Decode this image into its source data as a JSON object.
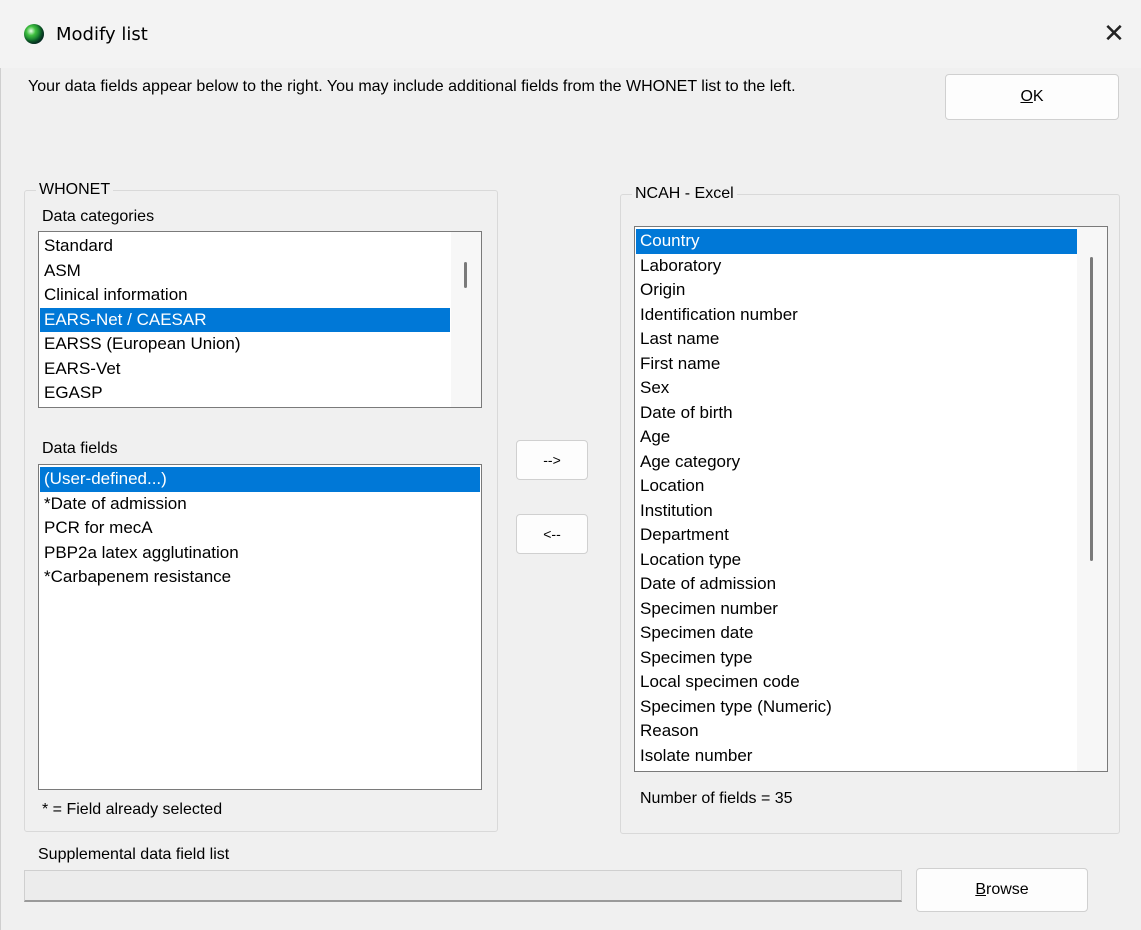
{
  "window": {
    "title": "Modify list"
  },
  "instructions": "Your data fields appear below to the right.  You may include additional fields from the WHONET list to the left.",
  "buttons": {
    "ok": {
      "mnemonic": "O",
      "rest": "K"
    },
    "add": "-->",
    "remove": "<--",
    "browse": {
      "mnemonic": "B",
      "rest": "rowse"
    }
  },
  "left_group": {
    "title": "WHONET",
    "categories_label": "Data categories",
    "categories": [
      {
        "label": "Standard",
        "selected": false
      },
      {
        "label": "ASM",
        "selected": false
      },
      {
        "label": "Clinical information",
        "selected": false
      },
      {
        "label": "EARS-Net / CAESAR",
        "selected": true
      },
      {
        "label": "EARSS (European Union)",
        "selected": false
      },
      {
        "label": "EARS-Vet",
        "selected": false
      },
      {
        "label": "EGASP",
        "selected": false
      }
    ],
    "fields_label": "Data fields",
    "fields": [
      {
        "label": "(User-defined...)",
        "selected": true
      },
      {
        "label": "*Date of admission",
        "selected": false
      },
      {
        "label": "PCR for mecA",
        "selected": false
      },
      {
        "label": "PBP2a latex agglutination",
        "selected": false
      },
      {
        "label": "*Carbapenem resistance",
        "selected": false
      }
    ],
    "footnote": "* = Field already selected"
  },
  "right_group": {
    "title": "NCAH - Excel",
    "fields": [
      {
        "label": "Country",
        "selected": true
      },
      {
        "label": "Laboratory",
        "selected": false
      },
      {
        "label": "Origin",
        "selected": false
      },
      {
        "label": "Identification number",
        "selected": false
      },
      {
        "label": "Last name",
        "selected": false
      },
      {
        "label": "First name",
        "selected": false
      },
      {
        "label": "Sex",
        "selected": false
      },
      {
        "label": "Date of birth",
        "selected": false
      },
      {
        "label": "Age",
        "selected": false
      },
      {
        "label": "Age category",
        "selected": false
      },
      {
        "label": "Location",
        "selected": false
      },
      {
        "label": "Institution",
        "selected": false
      },
      {
        "label": "Department",
        "selected": false
      },
      {
        "label": "Location type",
        "selected": false
      },
      {
        "label": "Date of admission",
        "selected": false
      },
      {
        "label": "Specimen number",
        "selected": false
      },
      {
        "label": "Specimen date",
        "selected": false
      },
      {
        "label": "Specimen type",
        "selected": false
      },
      {
        "label": "Local specimen code",
        "selected": false
      },
      {
        "label": "Specimen type (Numeric)",
        "selected": false
      },
      {
        "label": "Reason",
        "selected": false
      },
      {
        "label": "Isolate number",
        "selected": false
      }
    ],
    "count_text": "Number of fields = 35"
  },
  "supplemental": {
    "label": "Supplemental data field list",
    "value": ""
  },
  "colors": {
    "selection": "#0078d7",
    "dialog_bg": "#f0f0f0"
  },
  "icons": {
    "app": "globe-icon",
    "close": "close-icon"
  }
}
